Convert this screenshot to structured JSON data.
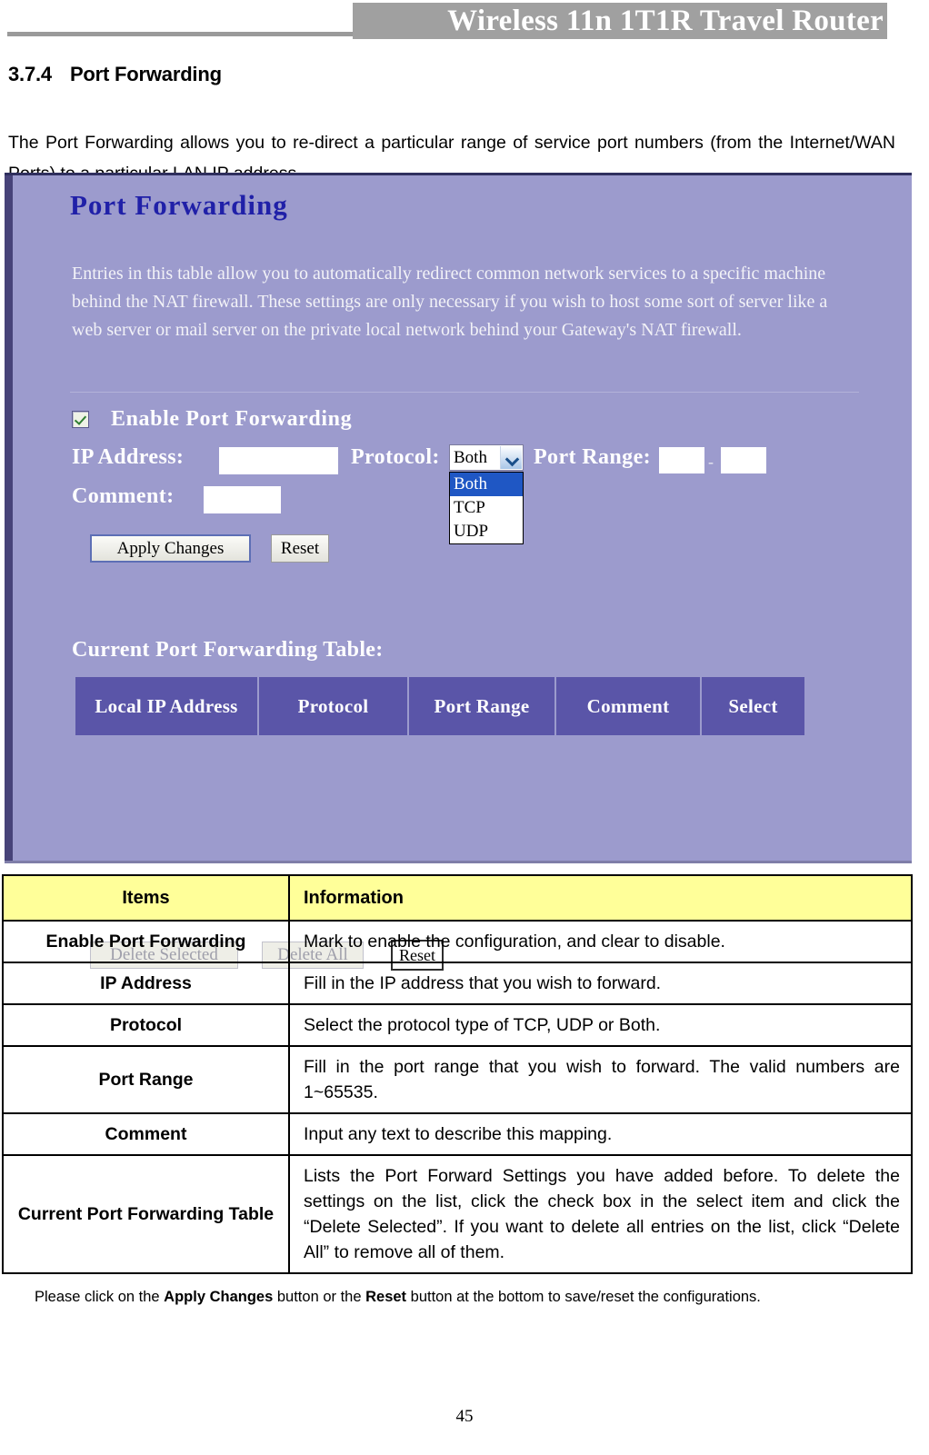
{
  "header": {
    "banner_title": "Wireless 11n 1T1R Travel Router"
  },
  "section": {
    "number": "3.7.4",
    "title": "Port Forwarding",
    "intro": "The Port Forwarding allows you to re-direct a particular range of service port numbers (from the Internet/WAN Ports) to a particular LAN IP address."
  },
  "router_ui": {
    "title": "Port Forwarding",
    "description": "Entries in this table allow you to automatically redirect common network services to a specific machine behind the NAT firewall. These settings are only necessary if you wish to host some sort of server like a web server or mail server on the private local network behind your Gateway's NAT firewall.",
    "enable_label": "Enable Port Forwarding",
    "enable_checked": true,
    "ip_label": "IP Address:",
    "ip_value": "",
    "protocol_label": "Protocol:",
    "protocol_value": "Both",
    "protocol_options": [
      "Both",
      "TCP",
      "UDP"
    ],
    "port_range_label": "Port Range:",
    "port_range_from": "",
    "port_range_to": "",
    "port_range_separator": "-",
    "comment_label": "Comment:",
    "comment_value": "",
    "apply_label": "Apply Changes",
    "reset_label": "Reset",
    "table_caption": "Current Port Forwarding Table:",
    "table_headers": [
      "Local IP Address",
      "Protocol",
      "Port Range",
      "Comment",
      "Select"
    ],
    "delete_selected_label": "Delete Selected",
    "delete_all_label": "Delete All",
    "reset2_label": "Reset"
  },
  "desc_table": {
    "headers": [
      "Items",
      "Information"
    ],
    "rows": [
      {
        "item": "Enable Port Forwarding",
        "info": "Mark to enable the configuration, and clear to disable."
      },
      {
        "item": "IP Address",
        "info": "Fill in the IP address that you wish to forward."
      },
      {
        "item": "Protocol",
        "info": "Select the protocol type of TCP, UDP or Both."
      },
      {
        "item": "Port Range",
        "info": "Fill in the port range that you wish to forward. The valid numbers are 1~65535."
      },
      {
        "item": "Comment",
        "info": "Input any text to describe this mapping."
      },
      {
        "item": "Current Port Forwarding Table",
        "info": "Lists the Port Forward Settings you have added before. To delete the settings on the list, click the check box in the select item and click the “Delete Selected”. If you want to delete all entries on the list, click “Delete All” to remove all of them."
      }
    ]
  },
  "footnote": {
    "prefix": "Please click on the ",
    "bold1": "Apply Changes",
    "middle": " button or the ",
    "bold2": "Reset",
    "suffix": " button at the bottom to save/reset the configurations."
  },
  "page_number": "45"
}
